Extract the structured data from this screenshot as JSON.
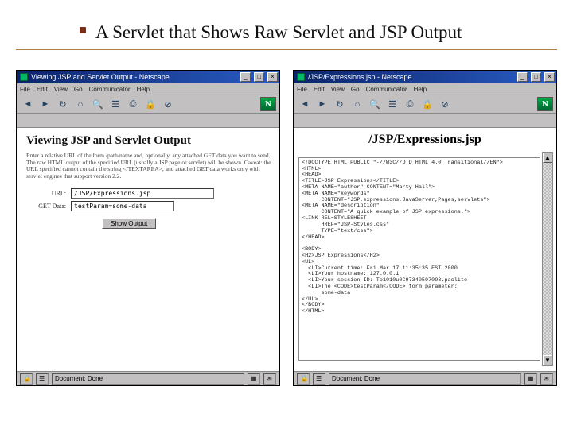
{
  "slide": {
    "title": "A Servlet that Shows Raw Servlet and JSP Output"
  },
  "left": {
    "window_title": "Viewing JSP and Servlet Output - Netscape",
    "menus": [
      "File",
      "Edit",
      "View",
      "Go",
      "Communicator",
      "Help"
    ],
    "h1": "Viewing JSP and Servlet Output",
    "blurb": "Enter a relative URL of the form /path/name and, optionally, any attached GET data you want to send. The raw HTML output of the specified URL (usually a JSP page or servlet) will be shown. Caveat: the URL specified cannot contain the string </TEXTAREA>, and attached GET data works only with servlet engines that support version 2.2.",
    "labels": {
      "url": "URL:",
      "get": "GET Data:"
    },
    "fields": {
      "url": "/JSP/Expressions.jsp",
      "get": "testParam=some-data"
    },
    "submit": "Show Output",
    "status": "Document: Done"
  },
  "right": {
    "window_title": "/JSP/Expressions.jsp - Netscape",
    "menus": [
      "File",
      "Edit",
      "View",
      "Go",
      "Communicator",
      "Help"
    ],
    "h1": "/JSP/Expressions.jsp",
    "code": "<!DOCTYPE HTML PUBLIC \"-//W3C//DTD HTML 4.0 Transitional//EN\">\n<HTML>\n<HEAD>\n<TITLE>JSP Expressions</TITLE>\n<META NAME=\"author\" CONTENT=\"Marty Hall\">\n<META NAME=\"keywords\"\n      CONTENT=\"JSP,expressions,JavaServer,Pages,servlets\">\n<META NAME=\"description\"\n      CONTENT=\"A quick example of JSP expressions.\">\n<LINK REL=STYLESHEET\n      HREF=\"JSP-Styles.css\"\n      TYPE=\"text/css\">\n</HEAD>\n\n<BODY>\n<H2>JSP Expressions</H2>\n<UL>\n  <LI>Current time: Fri Mar 17 11:35:35 EST 2000\n  <LI>Your hostname: 127.0.0.1\n  <LI>Your session ID: To1010u0C97340597093.paclite\n  <LI>The <CODE>testParam</CODE> form parameter:\n      some-data\n</UL>\n</BODY>\n</HTML>",
    "status": "Document: Done"
  }
}
